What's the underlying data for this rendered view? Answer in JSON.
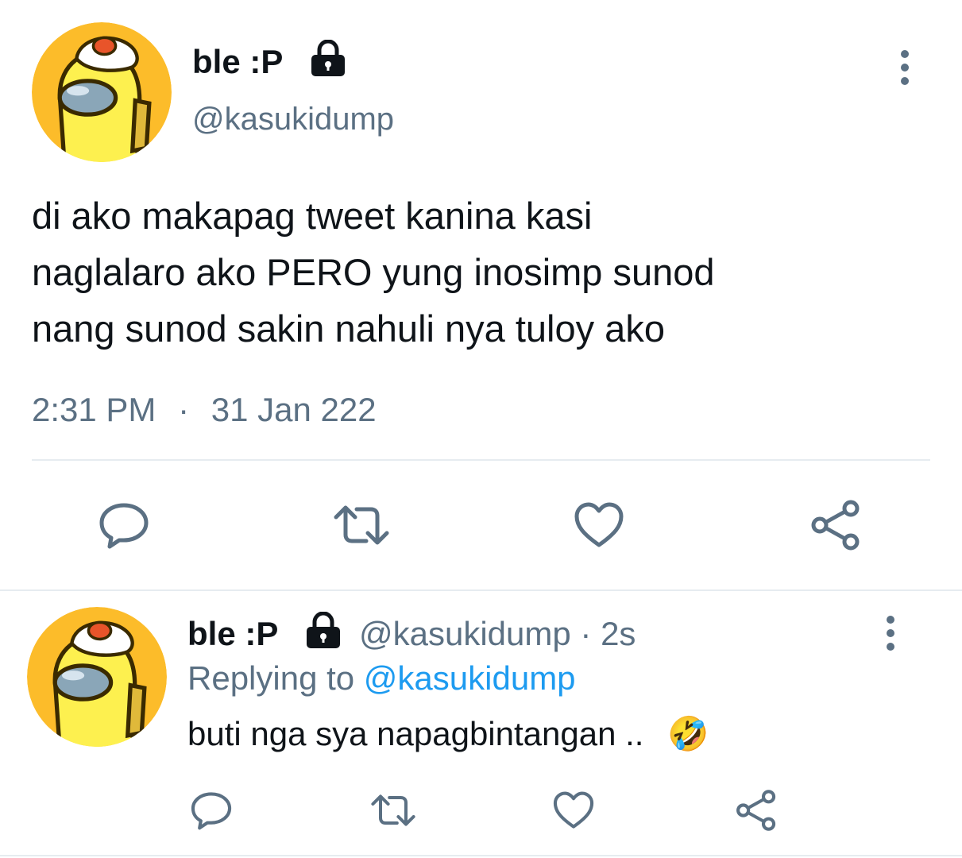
{
  "main_tweet": {
    "display_name": "ble :P",
    "handle": "@kasukidump",
    "text_lines": [
      "di ako makapag tweet kanina kasi",
      "naglalaro ako PERO yung inosimp sunod",
      "nang sunod sakin nahuli nya tuloy ako"
    ],
    "time": "2:31 PM",
    "separator": "·",
    "date": "31 Jan 222",
    "avatar_icon": "among-us-crewmate-avatar",
    "lock_icon": "lock-icon",
    "more_icon": "more-vertical-icon"
  },
  "actions": [
    "reply-icon",
    "retweet-icon",
    "like-icon",
    "share-icon"
  ],
  "reply_tweet": {
    "display_name": "ble :P",
    "handle_time": "@kasukidump · 2s",
    "replying_prefix": "Replying to",
    "replying_handle": "@kasukidump",
    "text": "buti nga sya napagbintangan ..",
    "emoji": "🤣"
  },
  "colors": {
    "text": "#0f1419",
    "secondary": "#5b7083",
    "accent": "#1d9bf0",
    "divider": "#e6ecf0",
    "avatar_bg": "#fcbc2a",
    "crewmate": "#fdf04f"
  }
}
